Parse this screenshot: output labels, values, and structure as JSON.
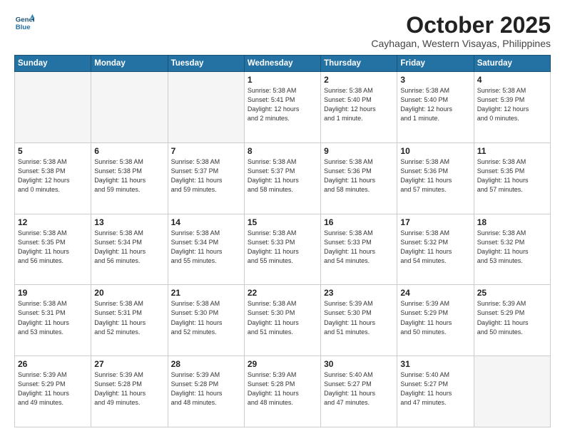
{
  "header": {
    "logo_line1": "General",
    "logo_line2": "Blue",
    "month": "October 2025",
    "location": "Cayhagan, Western Visayas, Philippines"
  },
  "weekdays": [
    "Sunday",
    "Monday",
    "Tuesday",
    "Wednesday",
    "Thursday",
    "Friday",
    "Saturday"
  ],
  "weeks": [
    [
      {
        "day": "",
        "info": "",
        "empty": true
      },
      {
        "day": "",
        "info": "",
        "empty": true
      },
      {
        "day": "",
        "info": "",
        "empty": true
      },
      {
        "day": "1",
        "info": "Sunrise: 5:38 AM\nSunset: 5:41 PM\nDaylight: 12 hours\nand 2 minutes.",
        "empty": false
      },
      {
        "day": "2",
        "info": "Sunrise: 5:38 AM\nSunset: 5:40 PM\nDaylight: 12 hours\nand 1 minute.",
        "empty": false
      },
      {
        "day": "3",
        "info": "Sunrise: 5:38 AM\nSunset: 5:40 PM\nDaylight: 12 hours\nand 1 minute.",
        "empty": false
      },
      {
        "day": "4",
        "info": "Sunrise: 5:38 AM\nSunset: 5:39 PM\nDaylight: 12 hours\nand 0 minutes.",
        "empty": false
      }
    ],
    [
      {
        "day": "5",
        "info": "Sunrise: 5:38 AM\nSunset: 5:38 PM\nDaylight: 12 hours\nand 0 minutes.",
        "empty": false
      },
      {
        "day": "6",
        "info": "Sunrise: 5:38 AM\nSunset: 5:38 PM\nDaylight: 11 hours\nand 59 minutes.",
        "empty": false
      },
      {
        "day": "7",
        "info": "Sunrise: 5:38 AM\nSunset: 5:37 PM\nDaylight: 11 hours\nand 59 minutes.",
        "empty": false
      },
      {
        "day": "8",
        "info": "Sunrise: 5:38 AM\nSunset: 5:37 PM\nDaylight: 11 hours\nand 58 minutes.",
        "empty": false
      },
      {
        "day": "9",
        "info": "Sunrise: 5:38 AM\nSunset: 5:36 PM\nDaylight: 11 hours\nand 58 minutes.",
        "empty": false
      },
      {
        "day": "10",
        "info": "Sunrise: 5:38 AM\nSunset: 5:36 PM\nDaylight: 11 hours\nand 57 minutes.",
        "empty": false
      },
      {
        "day": "11",
        "info": "Sunrise: 5:38 AM\nSunset: 5:35 PM\nDaylight: 11 hours\nand 57 minutes.",
        "empty": false
      }
    ],
    [
      {
        "day": "12",
        "info": "Sunrise: 5:38 AM\nSunset: 5:35 PM\nDaylight: 11 hours\nand 56 minutes.",
        "empty": false
      },
      {
        "day": "13",
        "info": "Sunrise: 5:38 AM\nSunset: 5:34 PM\nDaylight: 11 hours\nand 56 minutes.",
        "empty": false
      },
      {
        "day": "14",
        "info": "Sunrise: 5:38 AM\nSunset: 5:34 PM\nDaylight: 11 hours\nand 55 minutes.",
        "empty": false
      },
      {
        "day": "15",
        "info": "Sunrise: 5:38 AM\nSunset: 5:33 PM\nDaylight: 11 hours\nand 55 minutes.",
        "empty": false
      },
      {
        "day": "16",
        "info": "Sunrise: 5:38 AM\nSunset: 5:33 PM\nDaylight: 11 hours\nand 54 minutes.",
        "empty": false
      },
      {
        "day": "17",
        "info": "Sunrise: 5:38 AM\nSunset: 5:32 PM\nDaylight: 11 hours\nand 54 minutes.",
        "empty": false
      },
      {
        "day": "18",
        "info": "Sunrise: 5:38 AM\nSunset: 5:32 PM\nDaylight: 11 hours\nand 53 minutes.",
        "empty": false
      }
    ],
    [
      {
        "day": "19",
        "info": "Sunrise: 5:38 AM\nSunset: 5:31 PM\nDaylight: 11 hours\nand 53 minutes.",
        "empty": false
      },
      {
        "day": "20",
        "info": "Sunrise: 5:38 AM\nSunset: 5:31 PM\nDaylight: 11 hours\nand 52 minutes.",
        "empty": false
      },
      {
        "day": "21",
        "info": "Sunrise: 5:38 AM\nSunset: 5:30 PM\nDaylight: 11 hours\nand 52 minutes.",
        "empty": false
      },
      {
        "day": "22",
        "info": "Sunrise: 5:38 AM\nSunset: 5:30 PM\nDaylight: 11 hours\nand 51 minutes.",
        "empty": false
      },
      {
        "day": "23",
        "info": "Sunrise: 5:39 AM\nSunset: 5:30 PM\nDaylight: 11 hours\nand 51 minutes.",
        "empty": false
      },
      {
        "day": "24",
        "info": "Sunrise: 5:39 AM\nSunset: 5:29 PM\nDaylight: 11 hours\nand 50 minutes.",
        "empty": false
      },
      {
        "day": "25",
        "info": "Sunrise: 5:39 AM\nSunset: 5:29 PM\nDaylight: 11 hours\nand 50 minutes.",
        "empty": false
      }
    ],
    [
      {
        "day": "26",
        "info": "Sunrise: 5:39 AM\nSunset: 5:29 PM\nDaylight: 11 hours\nand 49 minutes.",
        "empty": false
      },
      {
        "day": "27",
        "info": "Sunrise: 5:39 AM\nSunset: 5:28 PM\nDaylight: 11 hours\nand 49 minutes.",
        "empty": false
      },
      {
        "day": "28",
        "info": "Sunrise: 5:39 AM\nSunset: 5:28 PM\nDaylight: 11 hours\nand 48 minutes.",
        "empty": false
      },
      {
        "day": "29",
        "info": "Sunrise: 5:39 AM\nSunset: 5:28 PM\nDaylight: 11 hours\nand 48 minutes.",
        "empty": false
      },
      {
        "day": "30",
        "info": "Sunrise: 5:40 AM\nSunset: 5:27 PM\nDaylight: 11 hours\nand 47 minutes.",
        "empty": false
      },
      {
        "day": "31",
        "info": "Sunrise: 5:40 AM\nSunset: 5:27 PM\nDaylight: 11 hours\nand 47 minutes.",
        "empty": false
      },
      {
        "day": "",
        "info": "",
        "empty": true
      }
    ]
  ]
}
